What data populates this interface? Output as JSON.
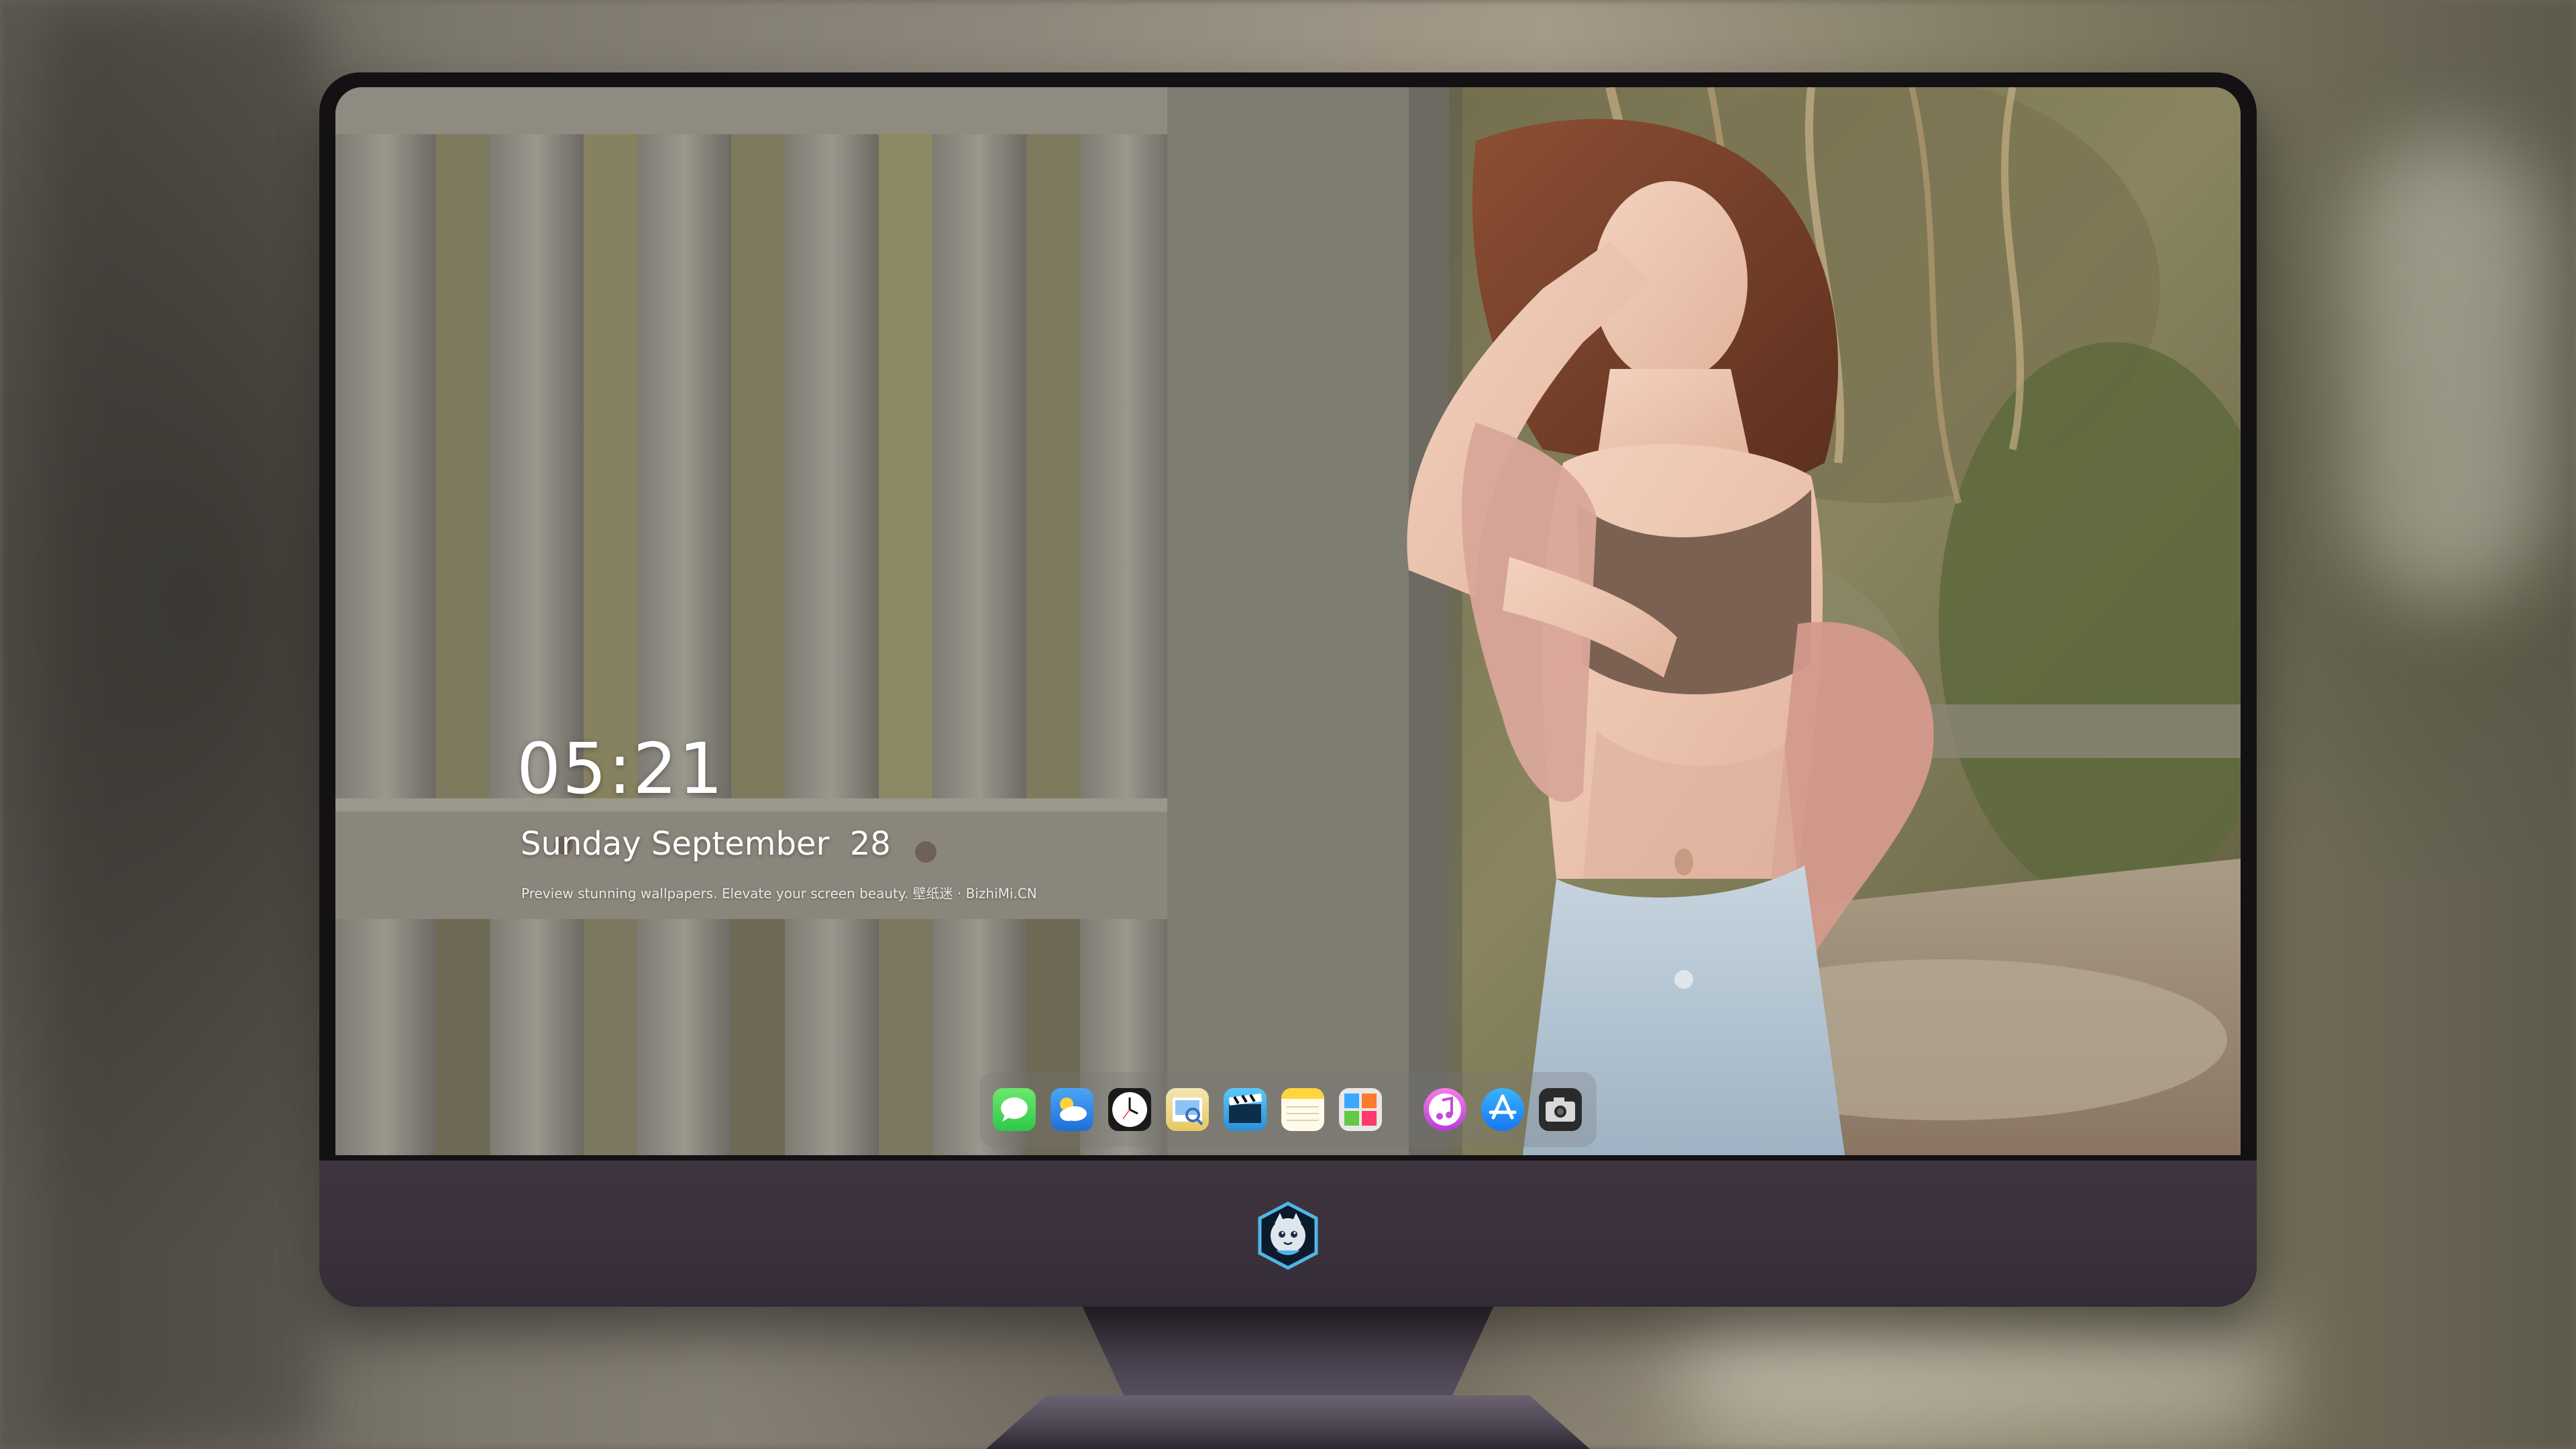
{
  "lock_screen": {
    "time": "05:21",
    "date": "Sunday September  28",
    "tagline": "Preview stunning wallpapers. Elevate your screen beauty. 壁纸迷 · BizhiMi.CN"
  },
  "dock": {
    "apps": [
      {
        "name": "Messages",
        "icon": "messages-icon"
      },
      {
        "name": "Weather",
        "icon": "weather-icon"
      },
      {
        "name": "Clock",
        "icon": "clock-icon"
      },
      {
        "name": "Preview",
        "icon": "preview-icon"
      },
      {
        "name": "Clips",
        "icon": "clips-icon"
      },
      {
        "name": "Notes",
        "icon": "notes-icon"
      },
      {
        "name": "Photo Booth",
        "icon": "photo-booth-icon"
      },
      {
        "name": "iTunes",
        "icon": "itunes-icon"
      },
      {
        "name": "App Store",
        "icon": "app-store-icon"
      },
      {
        "name": "Screenshot",
        "icon": "camera-icon"
      }
    ]
  },
  "colors": {
    "monitor_chin": "#3a313c",
    "bezel": "#141114",
    "text": "#ffffff"
  }
}
